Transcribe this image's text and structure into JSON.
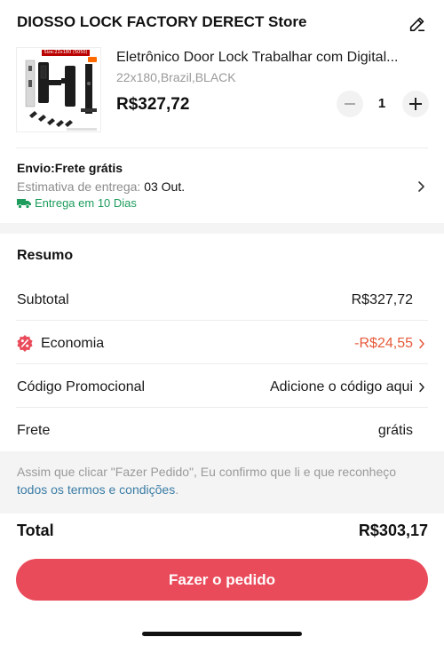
{
  "store": {
    "name": "DIOSSO LOCK FACTORY DERECT Store"
  },
  "product": {
    "title": "Eletrônico Door Lock Trabalhar com Digital...",
    "variant": "22x180,Brazil,BLACK",
    "price": "R$327,72",
    "quantity": "1",
    "image_tag": "Size:22x180 (5050)"
  },
  "shipping": {
    "title": "Envio:Frete grátis",
    "estimate_label": "Estimativa de entrega:",
    "estimate_date": "03 Out.",
    "delivery_time": "Entrega em 10 Dias"
  },
  "summary": {
    "title": "Resumo",
    "subtotal_label": "Subtotal",
    "subtotal_value": "R$327,72",
    "economy_label": "Economia",
    "economy_value": "-R$24,55",
    "promo_label": "Código Promocional",
    "promo_value": "Adicione o código aqui",
    "shipping_label": "Frete",
    "shipping_value": "grátis"
  },
  "notice": {
    "text": "Assim que clicar \"Fazer Pedido\", Eu confirmo que li e que reconheço ",
    "link": "todos os termos e condições",
    "suffix": "."
  },
  "total": {
    "label": "Total",
    "value": "R$303,17"
  },
  "action": {
    "order_button": "Fazer o pedido"
  },
  "colors": {
    "accent": "#ea4b5b",
    "discount": "#e65a3a",
    "success": "#1d9c5c",
    "link": "#3a7ca5"
  },
  "icons": {
    "edit": "pencil-icon",
    "minus": "minus-icon",
    "plus": "plus-icon",
    "truck": "truck-icon",
    "chevron": "chevron-right-icon",
    "discount": "percent-badge-icon"
  }
}
